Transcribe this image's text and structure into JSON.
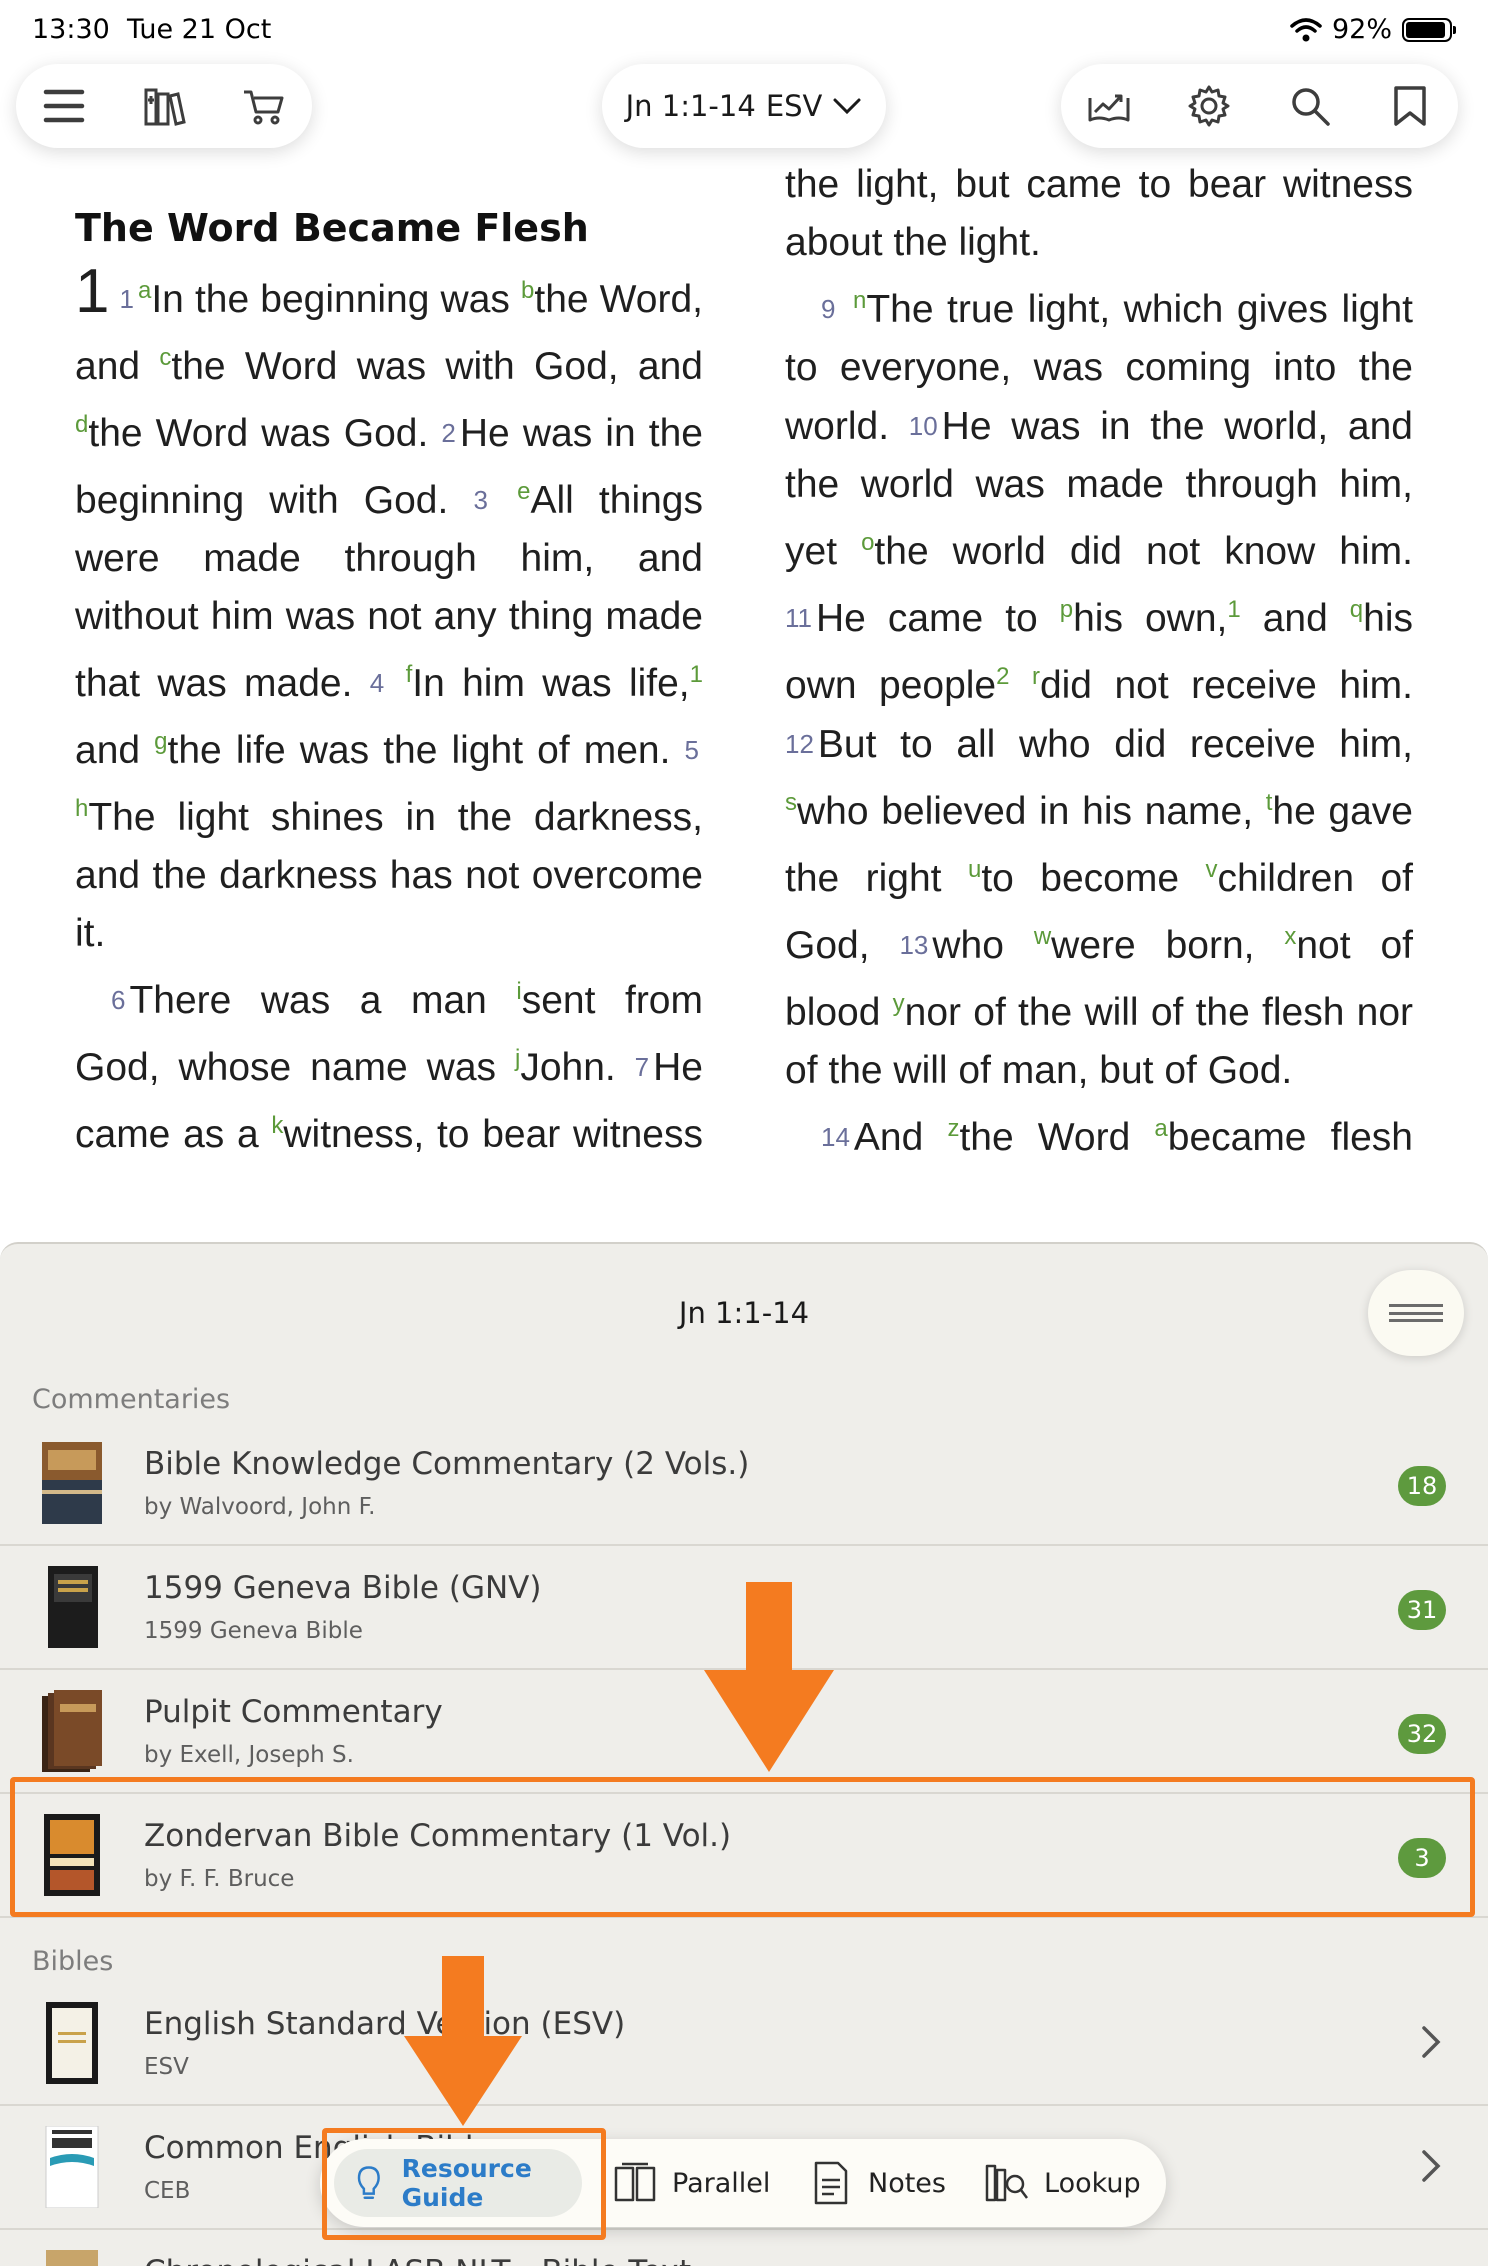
{
  "status": {
    "time": "13:30",
    "date": "Tue 21 Oct",
    "battery": "92%"
  },
  "toolbar": {
    "reference": "Jn 1:1-14",
    "version": "ESV"
  },
  "passage": {
    "heading": "The Word Became Flesh",
    "chapter": "1"
  },
  "panel": {
    "title": "Jn 1:1-14",
    "sections": {
      "commentaries": "Commentaries",
      "bibles": "Bibles"
    },
    "commentaries": [
      {
        "title": "Bible Knowledge Commentary (2 Vols.)",
        "subtitle": "by Walvoord, John F.",
        "count": "18"
      },
      {
        "title": "1599 Geneva Bible (GNV)",
        "subtitle": "1599 Geneva Bible",
        "count": "31"
      },
      {
        "title": "Pulpit Commentary",
        "subtitle": "by Exell, Joseph S.",
        "count": "32"
      },
      {
        "title": "Zondervan Bible Commentary (1 Vol.)",
        "subtitle": "by F. F. Bruce",
        "count": "3"
      }
    ],
    "bibles": [
      {
        "title": "English Standard Version (ESV)",
        "subtitle": "ESV"
      },
      {
        "title": "Common English Bible",
        "subtitle": "CEB"
      },
      {
        "title": "Chronological LASB NLT - Bible Text",
        "subtitle": ""
      }
    ]
  },
  "tabs": {
    "resource_guide": "Resource Guide",
    "parallel": "Parallel",
    "notes": "Notes",
    "lookup": "Lookup"
  },
  "colors": {
    "accent_green": "#5e9a3e",
    "highlight_orange": "#f47b20",
    "link_blue": "#2c7cc8"
  }
}
